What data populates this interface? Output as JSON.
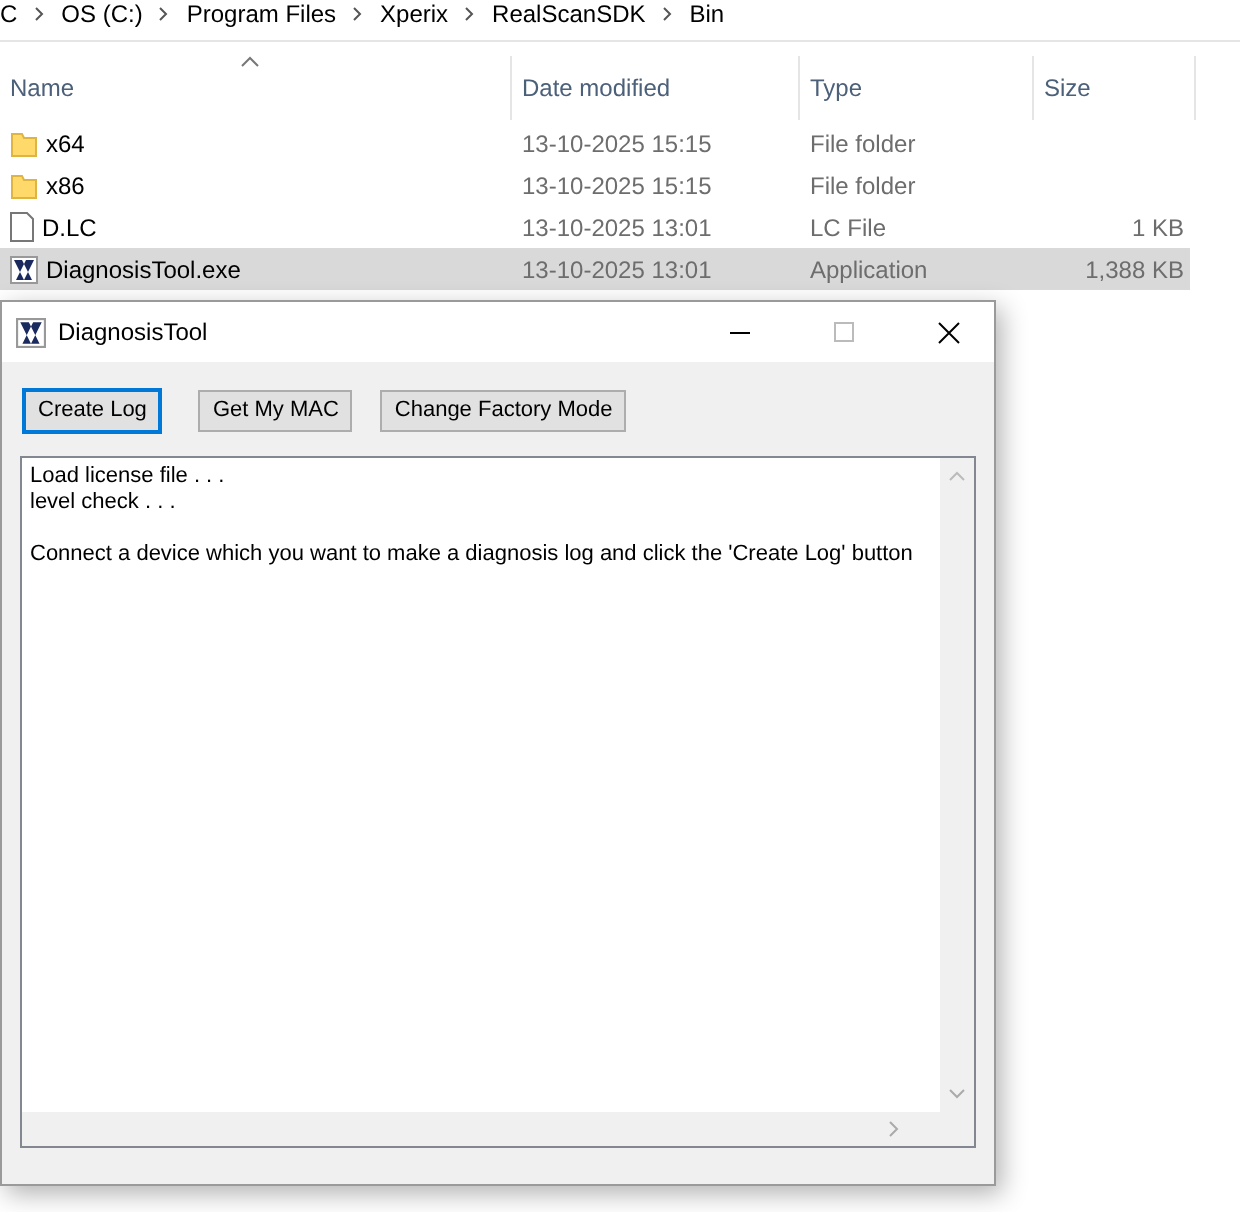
{
  "explorer": {
    "breadcrumb": [
      "C",
      "OS (C:)",
      "Program Files",
      "Xperix",
      "RealScanSDK",
      "Bin"
    ],
    "columns": [
      "Name",
      "Date modified",
      "Type",
      "Size"
    ],
    "rows": [
      {
        "kind": "folder",
        "name": "x64",
        "date": "13-10-2025 15:15",
        "type": "File folder",
        "selected": false
      },
      {
        "kind": "folder",
        "name": "x86",
        "date": "13-10-2025 15:15",
        "type": "File folder",
        "selected": false
      },
      {
        "kind": "file",
        "name": "D.LC",
        "date": "13-10-2025 13:01",
        "type": "LC File",
        "size": "1 KB",
        "selected": false
      },
      {
        "kind": "app",
        "name": "DiagnosisTool.exe",
        "date": "13-10-2025 13:01",
        "type": "Application",
        "size": "1,388 KB",
        "selected": true
      }
    ]
  },
  "dialog": {
    "title": "DiagnosisTool",
    "buttons": [
      {
        "label": "Create Log",
        "focused": true
      },
      {
        "label": "Get My MAC",
        "focused": false
      },
      {
        "label": "Change Factory Mode",
        "focused": false
      }
    ],
    "log": [
      [
        "Load license file . . .",
        "level check . . ."
      ],
      [
        "Connect a device which you want to make a diagnosis log and click the 'Create Log' button"
      ]
    ]
  }
}
